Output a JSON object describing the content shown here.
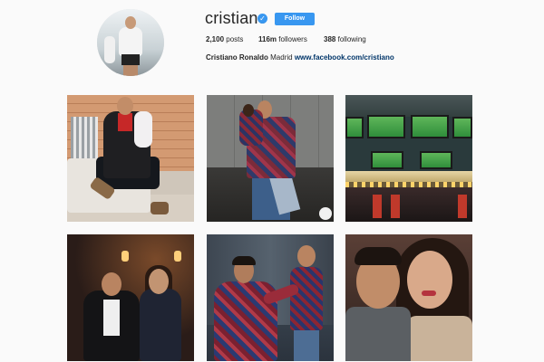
{
  "profile": {
    "username": "cristiano",
    "verified_icon": "verified-badge-icon",
    "follow_label": "Follow",
    "stats": {
      "posts_count": "2,100",
      "posts_label": "posts",
      "followers_count": "116m",
      "followers_label": "followers",
      "following_count": "388",
      "following_label": "following"
    },
    "bio": {
      "full_name": "Cristiano Ronaldo",
      "location": "Madrid",
      "website": "www.facebook.com/cristiano"
    }
  },
  "colors": {
    "accent": "#3897f0",
    "background": "#fafafa",
    "link": "#003569"
  }
}
